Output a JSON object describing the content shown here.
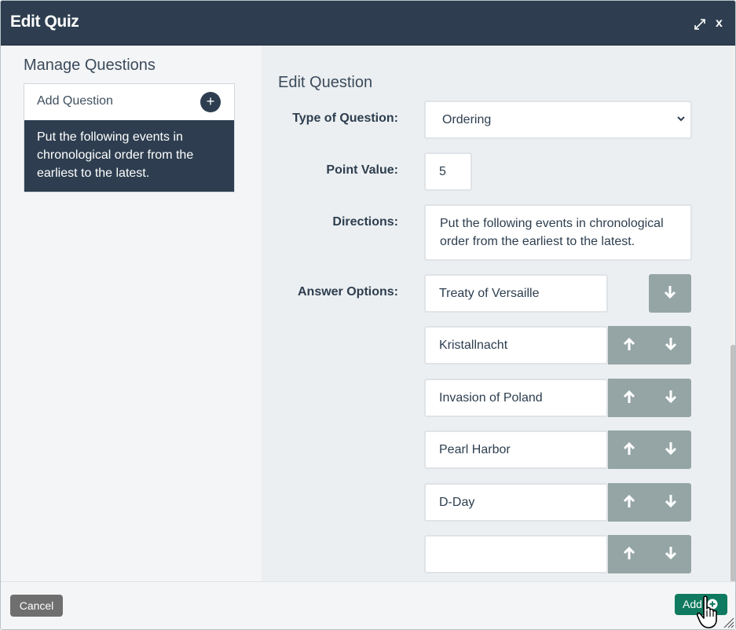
{
  "window": {
    "title": "Edit Quiz",
    "close_label": "x"
  },
  "left_panel": {
    "heading": "Manage Questions",
    "add_question_label": "Add Question",
    "add_question_icon": "+",
    "questions": [
      {
        "text": "Put the following events in chronological order from the earliest to the latest."
      }
    ]
  },
  "editor": {
    "heading": "Edit Question",
    "type_label": "Type of Question:",
    "type_value": "Ordering",
    "points_label": "Point Value:",
    "points_value": "5",
    "directions_label": "Directions:",
    "directions_value": "Put the following events in chronological order from the earliest to the latest.",
    "answers_label": "Answer Options:",
    "answers": [
      {
        "text": "Treaty of Versaille"
      },
      {
        "text": "Kristallnacht"
      },
      {
        "text": "Invasion of Poland"
      },
      {
        "text": "Pearl Harbor"
      },
      {
        "text": "D-Day"
      },
      {
        "text": ""
      }
    ]
  },
  "footer": {
    "cancel_label": "Cancel",
    "add_label": "Add"
  },
  "colors": {
    "header": "#2e3e50",
    "arrow_button": "#95a5a6",
    "add_button": "#0f7a5f",
    "cancel_button": "#6f6f6f"
  }
}
